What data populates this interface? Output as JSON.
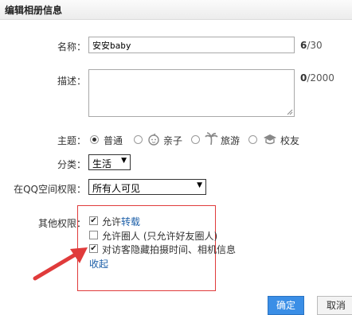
{
  "dialog": {
    "title": "编辑相册信息"
  },
  "form": {
    "name_label": "名称：",
    "name_value": "安安baby",
    "name_count": "6",
    "name_max": "/30",
    "desc_label": "描述：",
    "desc_value": "",
    "desc_count": "0",
    "desc_max": "/2000",
    "theme_label": "主题：",
    "themes": [
      {
        "label": "普通",
        "selected": true
      },
      {
        "label": "亲子",
        "selected": false,
        "icon": "baby-face-icon"
      },
      {
        "label": "旅游",
        "selected": false,
        "icon": "palm-tree-icon"
      },
      {
        "label": "校友",
        "selected": false,
        "icon": "graduation-cap-icon"
      }
    ],
    "category_label": "分类：",
    "category_value": "生活",
    "perm_label": "在QQ空间权限：",
    "perm_value": "所有人可见",
    "other_label": "其他权限：",
    "other_options": [
      {
        "prefix": "允许",
        "link": "转载",
        "suffix": "",
        "checked": true
      },
      {
        "prefix": "允许圈人 (只允许好友圈人)",
        "link": "",
        "suffix": "",
        "checked": false
      },
      {
        "prefix": "对访客隐藏拍摄时间、相机信息",
        "link": "",
        "suffix": "",
        "checked": true
      }
    ],
    "collapse_label": "收起"
  },
  "buttons": {
    "ok": "确定",
    "cancel": "取消"
  },
  "colors": {
    "annotation": "#e03b3b",
    "link": "#1d5fa8",
    "primary_button": "#3a8ee6"
  }
}
